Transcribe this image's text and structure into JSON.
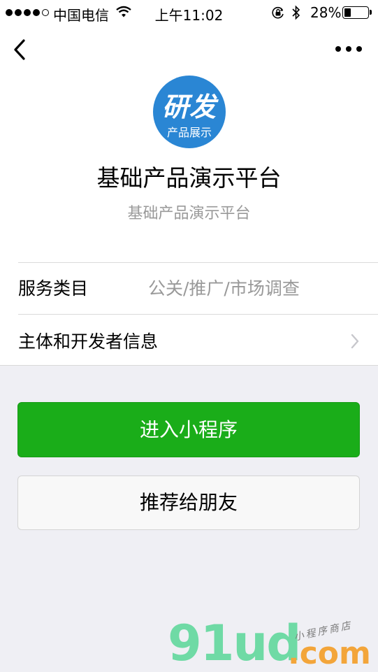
{
  "status_bar": {
    "carrier": "中国电信",
    "time": "上午11:02",
    "battery": "28%",
    "battery_level": 0.28
  },
  "nav": {
    "back_icon": "chevron-left-icon",
    "more_icon": "more-dots-icon"
  },
  "app": {
    "logo_title": "研发",
    "logo_subtitle": "产品展示",
    "name": "基础产品演示平台",
    "description": "基础产品演示平台"
  },
  "info": {
    "category_label": "服务类目",
    "category_value": "公关/推广/市场调查",
    "developer_label": "主体和开发者信息"
  },
  "buttons": {
    "enter": "进入小程序",
    "share": "推荐给朋友"
  },
  "watermark": {
    "brand": "91ud",
    "domain": ".com",
    "tagline": "小程序商店"
  },
  "colors": {
    "primary_green": "#1aad19",
    "logo_blue": "#2a86d4"
  }
}
